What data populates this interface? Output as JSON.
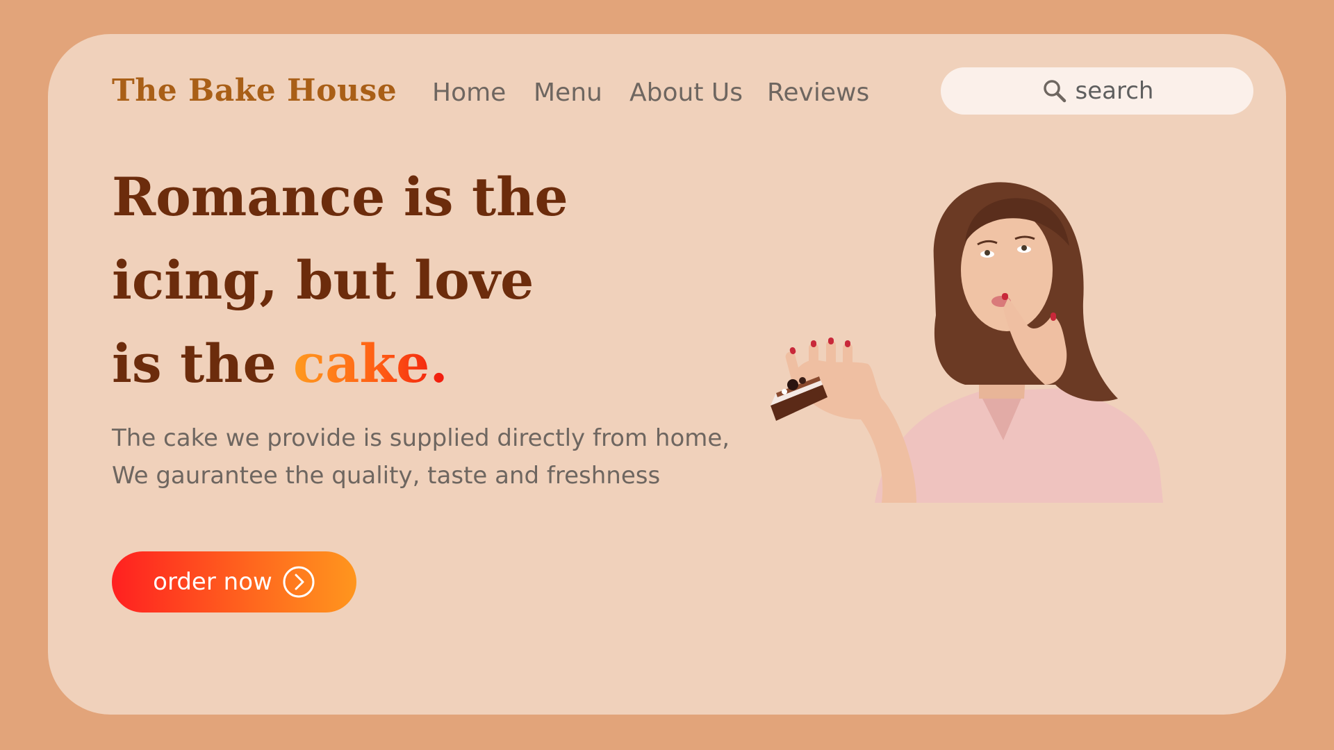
{
  "brand": {
    "name": "The Bake House"
  },
  "nav": {
    "items": [
      {
        "label": "Home"
      },
      {
        "label": "Menu"
      },
      {
        "label": "About Us"
      },
      {
        "label": "Reviews"
      }
    ]
  },
  "search": {
    "icon": "search-icon",
    "placeholder": "search"
  },
  "hero": {
    "headline_line1": "Romance is the",
    "headline_line2": "icing, but love",
    "headline_line3_prefix": "is the",
    "headline_accent": "cake.",
    "description_line1": "The cake we provide is supplied directly from home,",
    "description_line2": "We gaurantee the quality, taste and freshness",
    "cta_label": "order now",
    "cta_icon": "chevron-right-circle-icon",
    "image": "woman-eating-cake-photo"
  },
  "colors": {
    "page_background": "#E2A47A",
    "card_background": "#F0D1BB",
    "brand": "#A95F17",
    "headline": "#6C2C0C",
    "accent_gradient_start": "#FF9A1F",
    "accent_gradient_end": "#F0170E",
    "body_text": "#6E6660",
    "search_background": "#FBF0EA"
  }
}
